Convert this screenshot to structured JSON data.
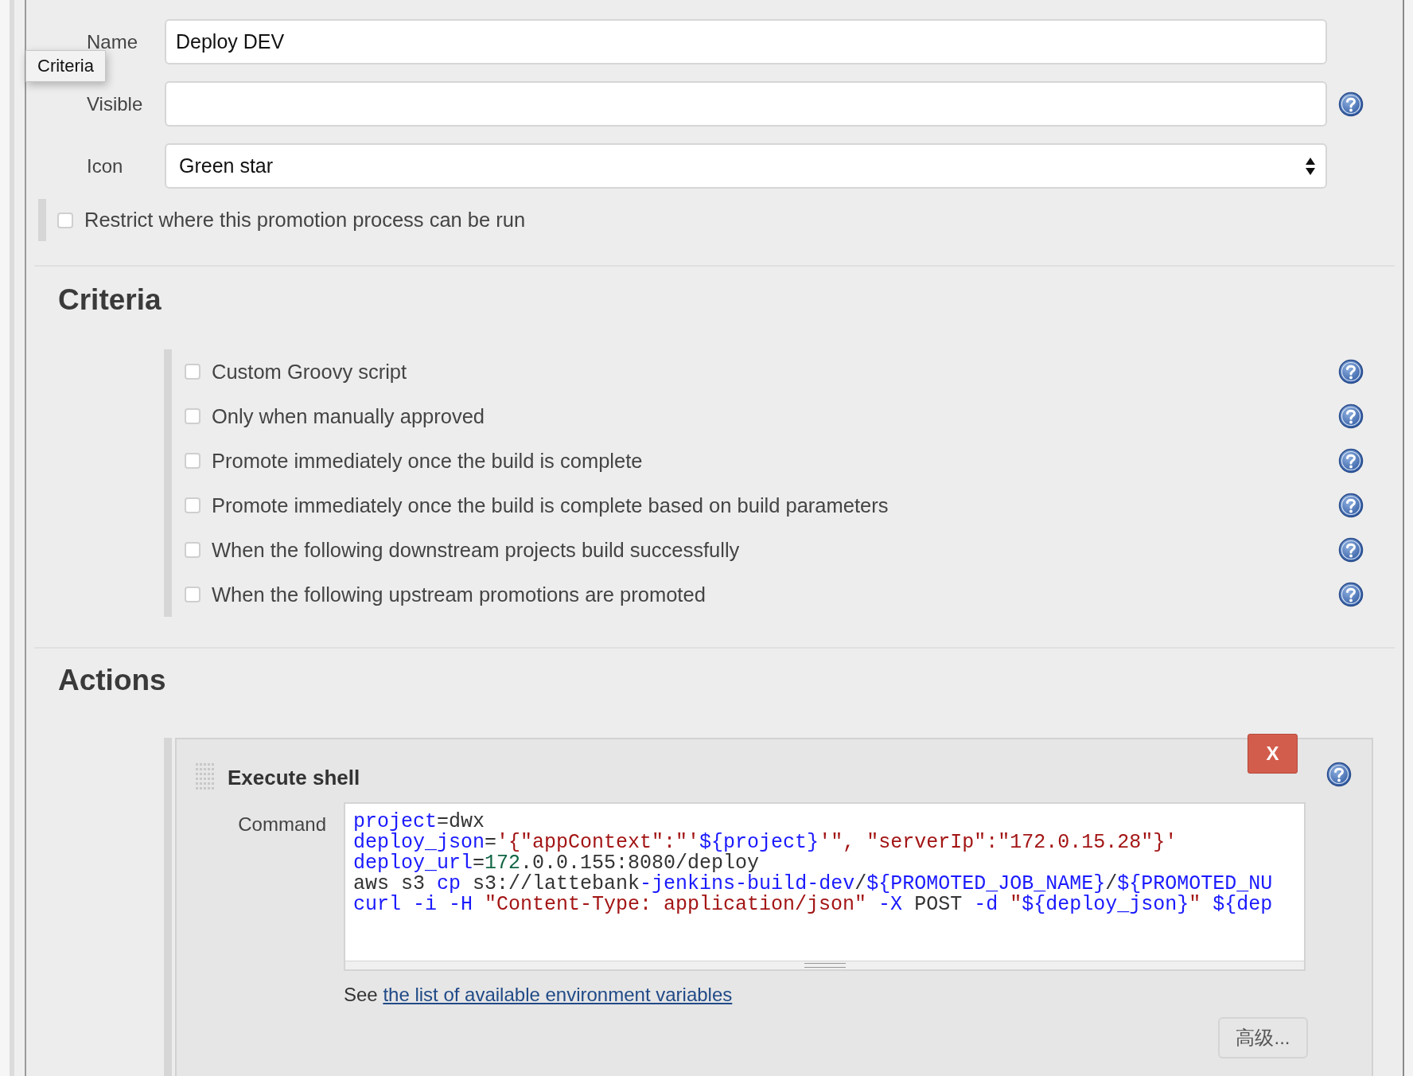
{
  "tooltip": "Criteria",
  "fields": [
    {
      "label": "Name",
      "kind": "text",
      "value": "Deploy DEV",
      "help": false
    },
    {
      "label": "Visible",
      "kind": "text",
      "help": true
    },
    {
      "label": "Icon",
      "kind": "select",
      "value": "Green star",
      "help": false
    }
  ],
  "restrict": {
    "label": "Restrict where this promotion process can be run",
    "checked": false
  },
  "criteria": {
    "title": "Criteria",
    "items": [
      {
        "label": "Custom Groovy script",
        "checked": false
      },
      {
        "label": "Only when manually approved",
        "checked": false
      },
      {
        "label": "Promote immediately once the build is complete",
        "checked": false
      },
      {
        "label": "Promote immediately once the build is complete based on build parameters",
        "checked": false
      },
      {
        "label": "When the following downstream projects build successfully",
        "checked": false
      },
      {
        "label": "When the following upstream promotions are promoted",
        "checked": false
      }
    ]
  },
  "actions": {
    "title": "Actions",
    "step": {
      "title": "Execute shell",
      "delete": "X",
      "command_label": "Command",
      "code": [
        [
          {
            "kind": "variable",
            "text": "project"
          },
          {
            "kind": "plain",
            "text": "=dwx"
          }
        ],
        [
          {
            "kind": "variable",
            "text": "deploy_json"
          },
          {
            "kind": "plain",
            "text": "="
          },
          {
            "kind": "string",
            "text": "'{\"appContext\":\"'"
          },
          {
            "kind": "variable",
            "text": "${project}"
          },
          {
            "kind": "string",
            "text": "'\", \"serverIp\":\"172.0.15.28\"}'"
          }
        ],
        [
          {
            "kind": "variable",
            "text": "deploy_url"
          },
          {
            "kind": "plain",
            "text": "="
          },
          {
            "kind": "number",
            "text": "172"
          },
          {
            "kind": "plain",
            "text": ".0.0.155:8080/deploy"
          }
        ],
        [
          {
            "kind": "plain",
            "text": "aws s3 "
          },
          {
            "kind": "variable",
            "text": "cp"
          },
          {
            "kind": "plain",
            "text": " s3://lattebank"
          },
          {
            "kind": "variable",
            "text": "-jenkins-build-dev"
          },
          {
            "kind": "plain",
            "text": "/"
          },
          {
            "kind": "variable",
            "text": "${PROMOTED_JOB_NAME}"
          },
          {
            "kind": "plain",
            "text": "/"
          },
          {
            "kind": "variable",
            "text": "${PROMOTED_NU"
          }
        ],
        [
          {
            "kind": "variable",
            "text": "curl -i -H "
          },
          {
            "kind": "string",
            "text": "\"Content-Type: application/json\""
          },
          {
            "kind": "variable",
            "text": " -X"
          },
          {
            "kind": "plain",
            "text": " POST "
          },
          {
            "kind": "variable",
            "text": "-d "
          },
          {
            "kind": "string",
            "text": "\""
          },
          {
            "kind": "variable",
            "text": "${deploy_json}"
          },
          {
            "kind": "string",
            "text": "\" "
          },
          {
            "kind": "variable",
            "text": "${dep"
          }
        ]
      ],
      "note": "See",
      "note_link": "the list of available environment variables",
      "advanced": "高级..."
    }
  }
}
